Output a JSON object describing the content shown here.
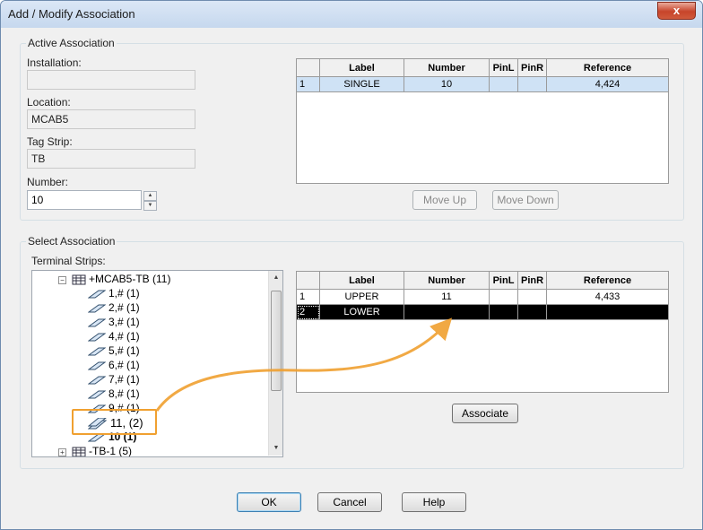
{
  "window": {
    "title": "Add / Modify Association",
    "close_glyph": "x"
  },
  "active": {
    "group_title": "Active Association",
    "installation_label": "Installation:",
    "installation_value": "",
    "location_label": "Location:",
    "location_value": "MCAB5",
    "tagstrip_label": "Tag Strip:",
    "tagstrip_value": "TB",
    "number_label": "Number:",
    "number_value": "10",
    "grid": {
      "headers": [
        "Label",
        "Number",
        "PinL",
        "PinR",
        "Reference"
      ],
      "rows": [
        {
          "num": "1",
          "label": "SINGLE",
          "number": "10",
          "pinl": "",
          "pinr": "",
          "reference": "4,424"
        }
      ]
    },
    "move_up": "Move Up",
    "move_down": "Move Down"
  },
  "select": {
    "group_title": "Select Association",
    "terminal_strips_label": "Terminal Strips:",
    "tree": {
      "root": "+MCAB5-TB (11)",
      "items": [
        "1,# (1)",
        "2,# (1)",
        "3,# (1)",
        "4,# (1)",
        "5,# (1)",
        "6,# (1)",
        "7,# (1)",
        "8,# (1)",
        "9,# (1)",
        "11,  (2)",
        "10 (1)"
      ],
      "next_root": "-TB-1 (5)"
    },
    "grid": {
      "headers": [
        "Label",
        "Number",
        "PinL",
        "PinR",
        "Reference"
      ],
      "rows": [
        {
          "num": "1",
          "label": "UPPER",
          "number": "11",
          "pinl": "",
          "pinr": "",
          "reference": "4,433"
        },
        {
          "num": "2",
          "label": "LOWER",
          "number": "",
          "pinl": "",
          "pinr": "",
          "reference": ""
        }
      ]
    },
    "associate": "Associate"
  },
  "buttons": {
    "ok": "OK",
    "cancel": "Cancel",
    "help": "Help"
  },
  "colors": {
    "callout": "#f0a030",
    "selection": "#cfe2f5"
  },
  "icons": {
    "expander": "minus",
    "strip": "terminal-strip-icon",
    "terminal": "terminal-icon"
  }
}
